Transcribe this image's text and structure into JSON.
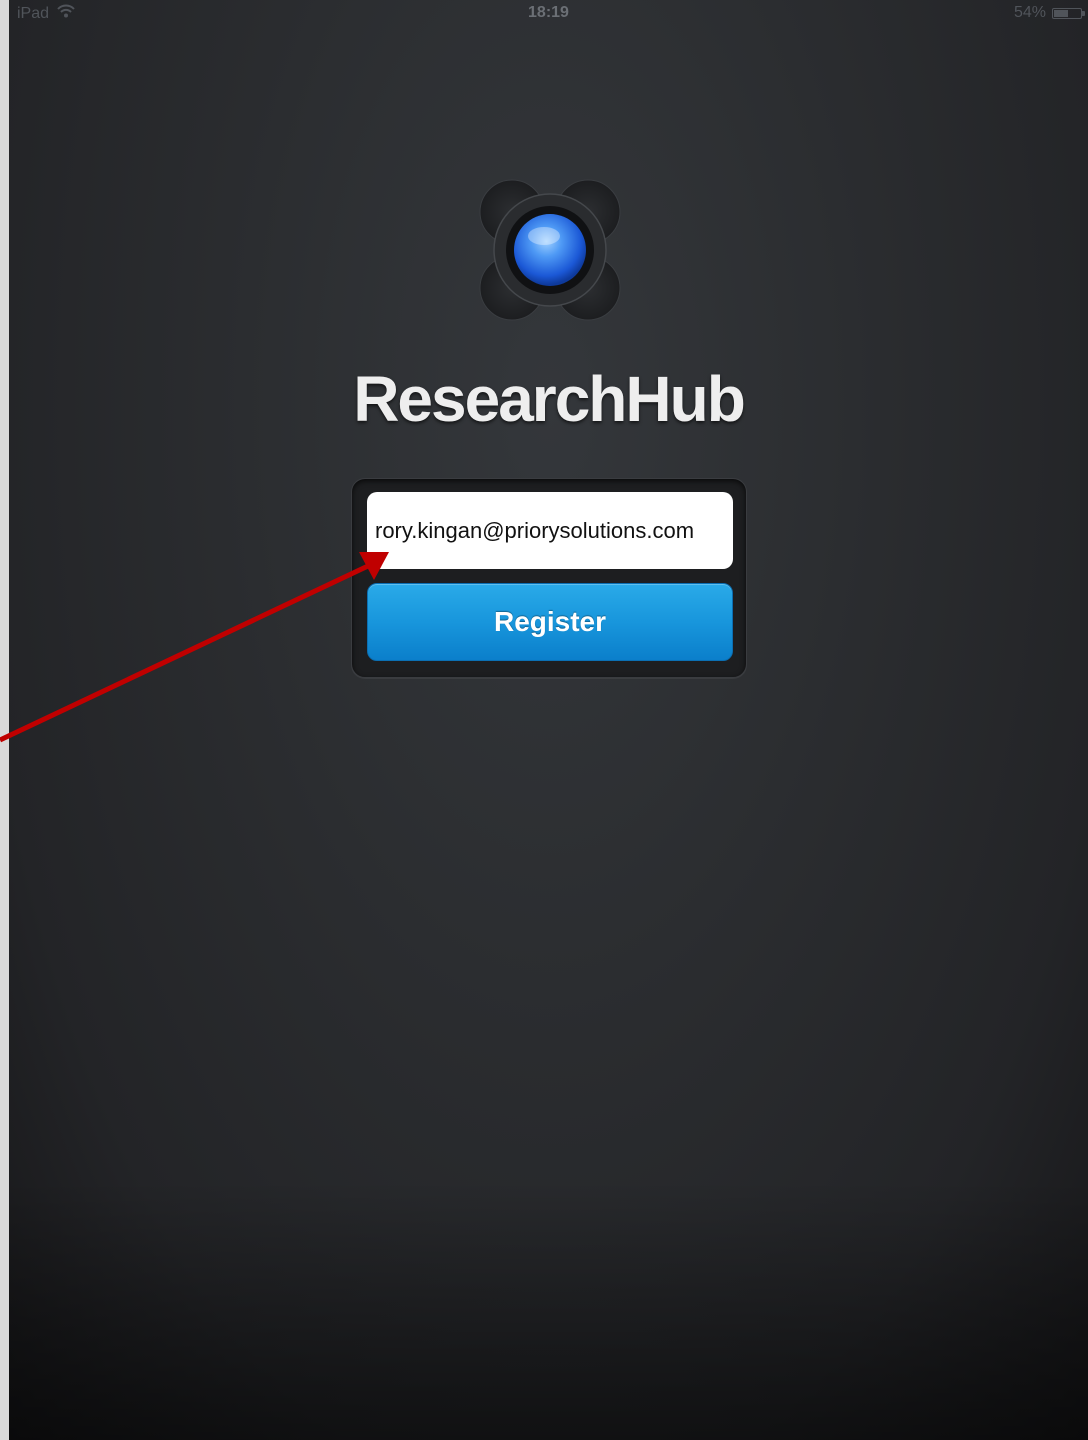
{
  "status_bar": {
    "device": "iPad",
    "time": "18:19",
    "battery_percent": "54%",
    "battery_level": 0.54,
    "wifi_icon": "wifi-icon"
  },
  "app": {
    "title": "ResearchHub",
    "logo_icon": "researchhub-logo-icon"
  },
  "form": {
    "email_value": "rory.kingan@priorysolutions.com",
    "register_label": "Register"
  },
  "colors": {
    "button_blue": "#1896dc",
    "annotation_arrow": "#c00000"
  }
}
